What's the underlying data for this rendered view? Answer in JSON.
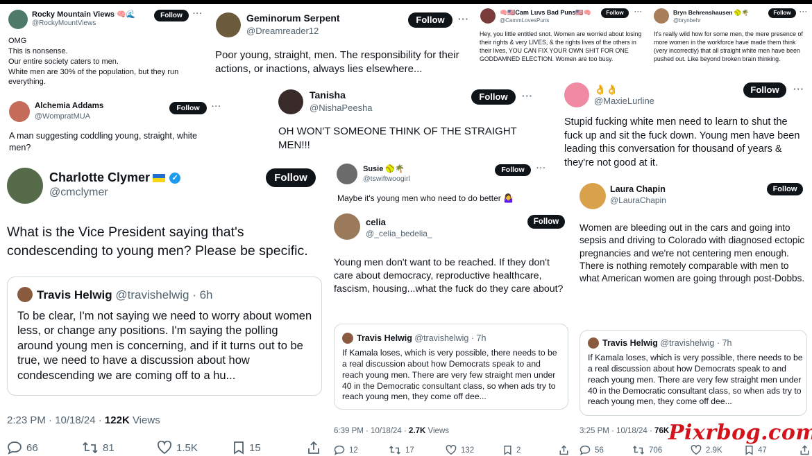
{
  "watermark": "Pixrbog.com",
  "follow_label": "Follow",
  "more_label": "···",
  "tweets": {
    "rocky": {
      "name": "Rocky Mountain Views 🧠🌊",
      "handle": "@RockyMountViews",
      "text": "OMG\nThis is nonsense.\nOur entire society caters to men.\nWhite men are 30% of the population, but they run everything."
    },
    "geminorum": {
      "name": "Geminorum Serpent",
      "handle": "@Dreamreader12",
      "text": "Poor young, straight, men. The responsibility for their actions, or inactions, always lies elsewhere..."
    },
    "cam": {
      "name": "🧠🇺🇸Cam Luvs Bad Puns🇺🇸🧠",
      "handle": "@CammLovesPuns",
      "text": "Hey, you little entitled snot. Women are worried about losing their rights & very LIVES, & the rights lives of the others in their lives, YOU CAN FIX YOUR OWN SHIT FOR ONE GODDAMNED ELECTION. Women are too busy."
    },
    "bryn": {
      "name": "Bryn Behrenshausen 🥎🌴",
      "handle": "@brynbehr",
      "text": "It's really wild how for some men, the mere presence of more women in the workforce have made them think (very incorrectly) that all straight white men have been pushed out. Like beyond broken brain thinking."
    },
    "alchemia": {
      "name": "Alchemia Addams",
      "handle": "@WompratMUA",
      "text": "A man suggesting coddling young, straight, white men?"
    },
    "tanisha": {
      "name": "Tanisha",
      "handle": "@NishaPeesha",
      "text": "OH WON'T SOMEONE THINK OF THE STRAIGHT MEN!!!"
    },
    "maxie": {
      "name": "👌👌",
      "handle": "@MaxieLurline",
      "text": "Stupid fucking white men need to learn to shut the fuck up and sit the fuck down. Young men have been leading this conversation for thousand of years & they're not good at it."
    },
    "charlotte": {
      "name": "Charlotte Clymer",
      "handle": "@cmclymer",
      "text": "What is the Vice President saying that's condescending to young men? Please be specific.",
      "quote": {
        "name": "Travis Helwig",
        "handle": "@travishelwig · 6h",
        "text": "To be clear, I'm not saying we need to worry about women less, or change any positions. I'm saying the polling around young men is concerning, and if it turns out to be true, we need to have a discussion about how condescending we are coming off to a hu..."
      },
      "time": "2:23 PM · 10/18/24 · ",
      "views": "122K",
      "views_label": " Views",
      "replies": "66",
      "reposts": "81",
      "likes": "1.5K",
      "bookmarks": "15"
    },
    "susie": {
      "name": "Susie 🥎🌴",
      "handle": "@tswiftwoogirl",
      "text": "Maybe it's young men who need to do better 🤷‍♀️"
    },
    "celia": {
      "name": "celia",
      "handle": "@_celia_bedelia_",
      "text": "Young men don't want to be reached. If they don't care about democracy, reproductive healthcare, fascism, housing...what the fuck do they care about?",
      "quote": {
        "name": "Travis Helwig",
        "handle": "@travishelwig · 7h",
        "text": "If Kamala loses, which is very possible, there needs to be a real discussion about how Democrats speak to and reach young men. There are very few straight men under 40 in the Democratic consultant class, so when ads try to reach young men, they come off dee..."
      },
      "time": "6:39 PM · 10/18/24 · ",
      "views": "2.7K",
      "views_label": " Views",
      "replies": "12",
      "reposts": "17",
      "likes": "132",
      "bookmarks": "2"
    },
    "laura": {
      "name": "Laura Chapin",
      "handle": "@LauraChapin",
      "text": "Women are bleeding out in the cars and going into sepsis and driving to Colorado with diagnosed ectopic pregnancies and we're not centering men enough.\nThere is nothing remotely comparable with men to what American women are going through post-Dobbs.",
      "quote": {
        "name": "Travis Helwig",
        "handle": "@travishelwig · 7h",
        "text": "If Kamala loses, which is very possible, there needs to be a real discussion about how Democrats speak to and reach young men. There are very few straight men under 40 in the Democratic consultant class, so when ads try to reach young men, they come off dee..."
      },
      "time": "3:25 PM · 10/18/24 · ",
      "views": "76K",
      "replies": "56",
      "reposts": "706",
      "likes": "2.9K",
      "bookmarks": "47"
    }
  }
}
